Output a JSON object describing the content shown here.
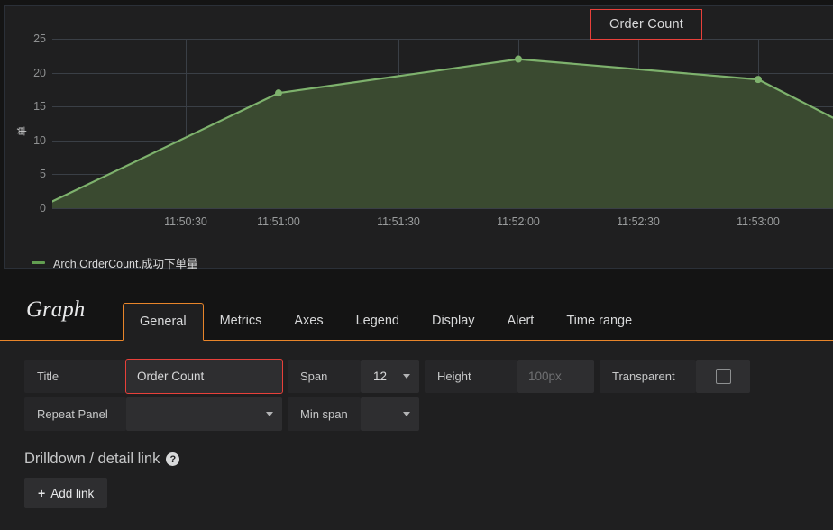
{
  "panel": {
    "title": "Order Count",
    "title_highlight_color": "#e8403a"
  },
  "chart_data": {
    "type": "area",
    "title": "Order Count",
    "xlabel": "",
    "ylabel": "单",
    "ylim": [
      0,
      25
    ],
    "yticks": [
      0,
      5,
      10,
      15,
      20,
      25
    ],
    "xticks": [
      "11:50:30",
      "11:51:00",
      "11:51:30",
      "11:52:00",
      "11:52:30",
      "11:53:00"
    ],
    "grid": true,
    "legend_position": "bottom-left",
    "line_color": "#7eb26d",
    "fill_color": "#3a4a30",
    "series": [
      {
        "name": "Arch.OrderCount.成功下单量",
        "points": [
          {
            "x": "11:50:15",
            "y": 1
          },
          {
            "x": "11:51:00",
            "y": 17
          },
          {
            "x": "11:52:00",
            "y": 22
          },
          {
            "x": "11:53:00",
            "y": 19
          },
          {
            "x": "11:53:20",
            "y": 13
          }
        ]
      }
    ]
  },
  "editor": {
    "kind": "Graph",
    "tabs": [
      {
        "label": "General",
        "active": true
      },
      {
        "label": "Metrics",
        "active": false
      },
      {
        "label": "Axes",
        "active": false
      },
      {
        "label": "Legend",
        "active": false
      },
      {
        "label": "Display",
        "active": false
      },
      {
        "label": "Alert",
        "active": false
      },
      {
        "label": "Time range",
        "active": false
      }
    ],
    "general": {
      "title_label": "Title",
      "title_value": "Order Count",
      "span_label": "Span",
      "span_value": "12",
      "height_label": "Height",
      "height_placeholder": "100px",
      "height_value": "",
      "transparent_label": "Transparent",
      "transparent_checked": false,
      "repeat_panel_label": "Repeat Panel",
      "repeat_panel_value": "",
      "min_span_label": "Min span",
      "min_span_value": ""
    },
    "drilldown": {
      "heading": "Drilldown / detail link",
      "help_glyph": "?",
      "add_link_label": "Add link",
      "add_link_plus": "+"
    }
  }
}
